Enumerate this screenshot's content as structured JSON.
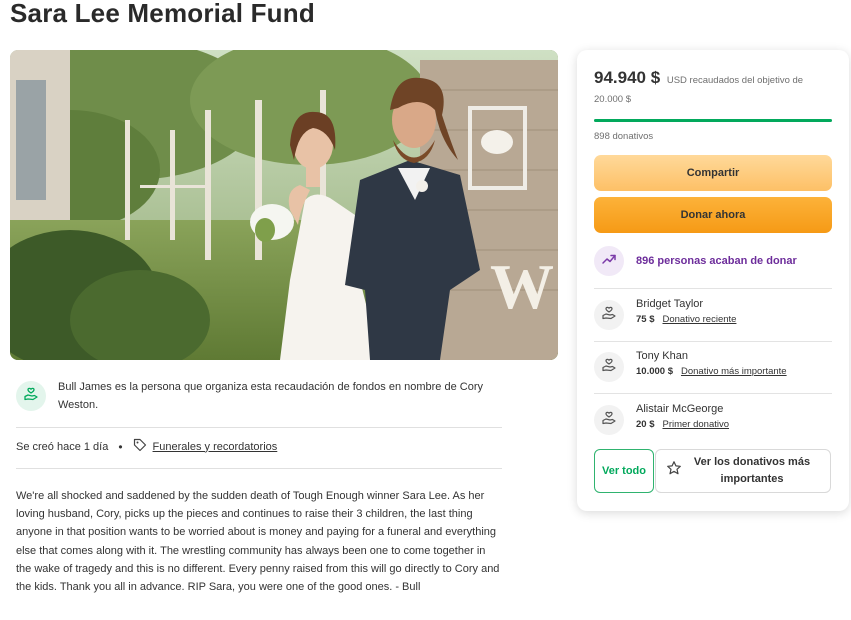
{
  "campaign": {
    "title": "Sara Lee Memorial Fund"
  },
  "organizer": {
    "text": "Bull James es la persona que organiza esta recaudación de fondos en nombre de Cory Weston."
  },
  "meta": {
    "created": "Se creó hace 1 día",
    "separator": "•",
    "category": "Funerales y recordatorios"
  },
  "story": "We're all shocked and saddened by the sudden death of Tough Enough winner Sara Lee. As her loving husband, Cory, picks up the pieces and continues to raise their 3 children, the last thing anyone in that position wants to be worried about is money and paying for a funeral and everything else that comes along with it. The wrestling community has always been one to come together in the wake of tragedy and this is no different. Every penny raised from this will go directly to Cory and the kids. Thank you all in advance. RIP Sara, you were one of the good ones. - Bull",
  "photo": {
    "sign_letter": "W"
  },
  "donation_card": {
    "amount": "94.940 $",
    "goal_text": "USD recaudados del objetivo de 20.000 $",
    "progress_fraction": 1.0,
    "donations_count": "898 donativos",
    "share_label": "Compartir",
    "donate_label": "Donar ahora",
    "recent_activity": "896 personas acaban de donar",
    "donors": [
      {
        "name": "Bridget Taylor",
        "amount": "75 $",
        "tag": "Donativo reciente"
      },
      {
        "name": "Tony Khan",
        "amount": "10.000 $",
        "tag": "Donativo más importante"
      },
      {
        "name": "Alistair McGeorge",
        "amount": "20 $",
        "tag": "Primer donativo"
      }
    ],
    "see_all_label": "Ver todo",
    "see_top_label": "Ver los donativos más importantes"
  },
  "colors": {
    "accent_green": "#02a95c",
    "share_yellow": "#fdc066",
    "donate_orange": "#f69a16",
    "trend_purple": "#6d2d9b"
  },
  "icons": {
    "organizer": "heart-hand-icon",
    "category": "tag-icon",
    "trend": "trending-up-icon",
    "donor": "heart-hand-icon",
    "top": "star-icon"
  }
}
